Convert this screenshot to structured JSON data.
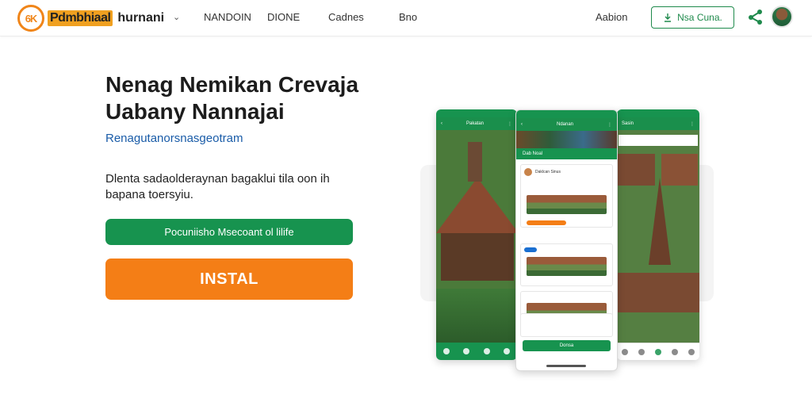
{
  "brand": {
    "logo_mark": "6K",
    "name_highlight": "Pdmbhiaal",
    "name_rest": "hurnani"
  },
  "nav": {
    "caret": "⌄",
    "links": [
      "NANDOIN",
      "DIONE",
      "Cadnes",
      "Bno"
    ],
    "right_link": "Aabion",
    "outline_button": "Nsa Cuna.",
    "share_icon": "share-icon",
    "avatar_icon": "avatar"
  },
  "hero": {
    "title": "Nenag Nemikan Crevaja Uabany Nannajai",
    "subtitle": "Renagutanorsnasgeotram",
    "description": "Dlenta sadaolderaynan bagaklui tila oon ih bapana toersyiu.",
    "green_button": "Pocuniisho Msecoant ol lilife",
    "orange_button": "INSTAL"
  },
  "phones": {
    "left_title": "Pakatan",
    "middle_title": "Ndanan",
    "middle_header": "Dab Noal",
    "middle_post": "Daklcan Sinus",
    "middle_button": "Donsa",
    "right_title": "Sasin"
  },
  "colors": {
    "green": "#17934f",
    "orange": "#f47e16",
    "link_blue": "#1a5ca8"
  }
}
